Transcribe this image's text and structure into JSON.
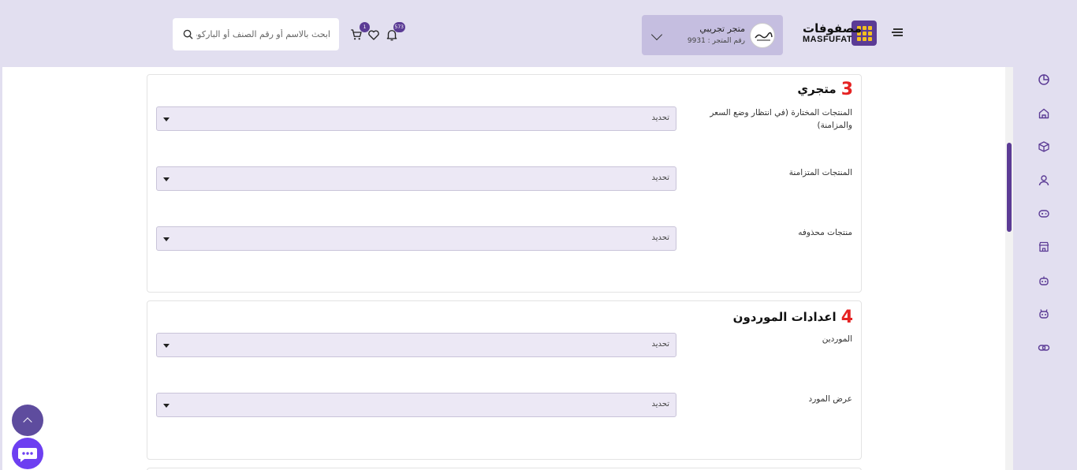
{
  "header": {
    "logo": {
      "arabic": "مصفوفات",
      "english": "MASFUFAT"
    },
    "store": {
      "name": "متجر تجريبي",
      "number": "رقم المتجر : 9931"
    },
    "notifications": {
      "count": "573"
    },
    "cart": {
      "count": "1"
    },
    "search": {
      "placeholder": "ابحث بالاسم أو رقم الصنف أو الباركود"
    }
  },
  "sections": [
    {
      "number": "3",
      "title": "متجري",
      "fields": [
        {
          "label": "المنتجات المختارة (في انتظار وضع السعر والمزامنة)",
          "value": "تحديد"
        },
        {
          "label": "المنتجات المتزامنة",
          "value": "تحديد"
        },
        {
          "label": "منتجات محذوفه",
          "value": "تحديد"
        }
      ]
    },
    {
      "number": "4",
      "title": "اعدادات الموردون",
      "fields": [
        {
          "label": "الموردين",
          "value": "تحديد"
        },
        {
          "label": "عرض المورد",
          "value": "تحديد"
        }
      ]
    }
  ],
  "sidebar": {
    "icons": [
      "dashboard-icon",
      "home-icon",
      "box-icon",
      "users-icon",
      "gamepad-icon",
      "store-icon",
      "robot-icon",
      "robot-alt-icon",
      "link-icon"
    ]
  },
  "colors": {
    "brand": "#5b3b95",
    "accent": "#e52323",
    "background": "#e2dff0"
  }
}
